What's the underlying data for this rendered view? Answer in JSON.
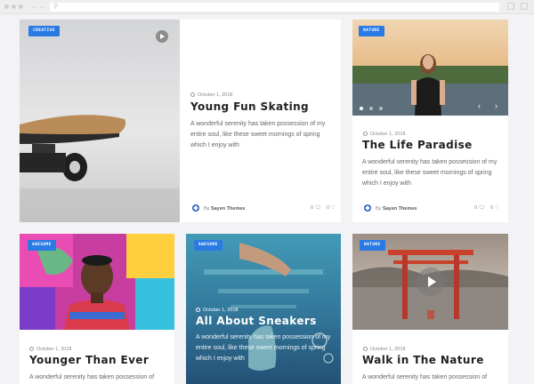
{
  "browser": {
    "search_icon": "search-icon"
  },
  "colors": {
    "accent": "#2a7ae4",
    "page_bg": "#f3f3f5"
  },
  "posts": [
    {
      "badge": "CREATIVE",
      "date": "October 1, 2018",
      "title": "Young Fun Skating",
      "excerpt": "A wonderful serenity has taken possession of my entire soul, like these sweet mornings of spring which I enjoy with",
      "author_prefix": "By",
      "author": "Sayen Themes",
      "likes": "0",
      "comments": "0",
      "media_type": "video"
    },
    {
      "badge": "NATURE",
      "date": "October 1, 2018",
      "title": "The Life Paradise",
      "excerpt": "A wonderful serenity has taken possession of my entire soul, like these sweet mornings of spring which I enjoy with",
      "author_prefix": "By",
      "author": "Sayen Themes",
      "likes": "0",
      "comments": "0",
      "media_type": "gallery"
    },
    {
      "badge": "AWESOME",
      "date": "October 1, 2018",
      "title": "Younger Than Ever",
      "excerpt": "A wonderful serenity has taken possession of",
      "media_type": "image"
    },
    {
      "badge": "AWESOME",
      "date": "October 1, 2018",
      "title": "All About Sneakers",
      "excerpt": "A wonderful serenity has taken possession of my entire soul, like these sweet mornings of spring which I enjoy with",
      "media_type": "image"
    },
    {
      "badge": "NATURE",
      "date": "October 1, 2018",
      "title": "Walk in The Nature",
      "excerpt": "A wonderful serenity has taken possession of",
      "media_type": "video"
    }
  ]
}
